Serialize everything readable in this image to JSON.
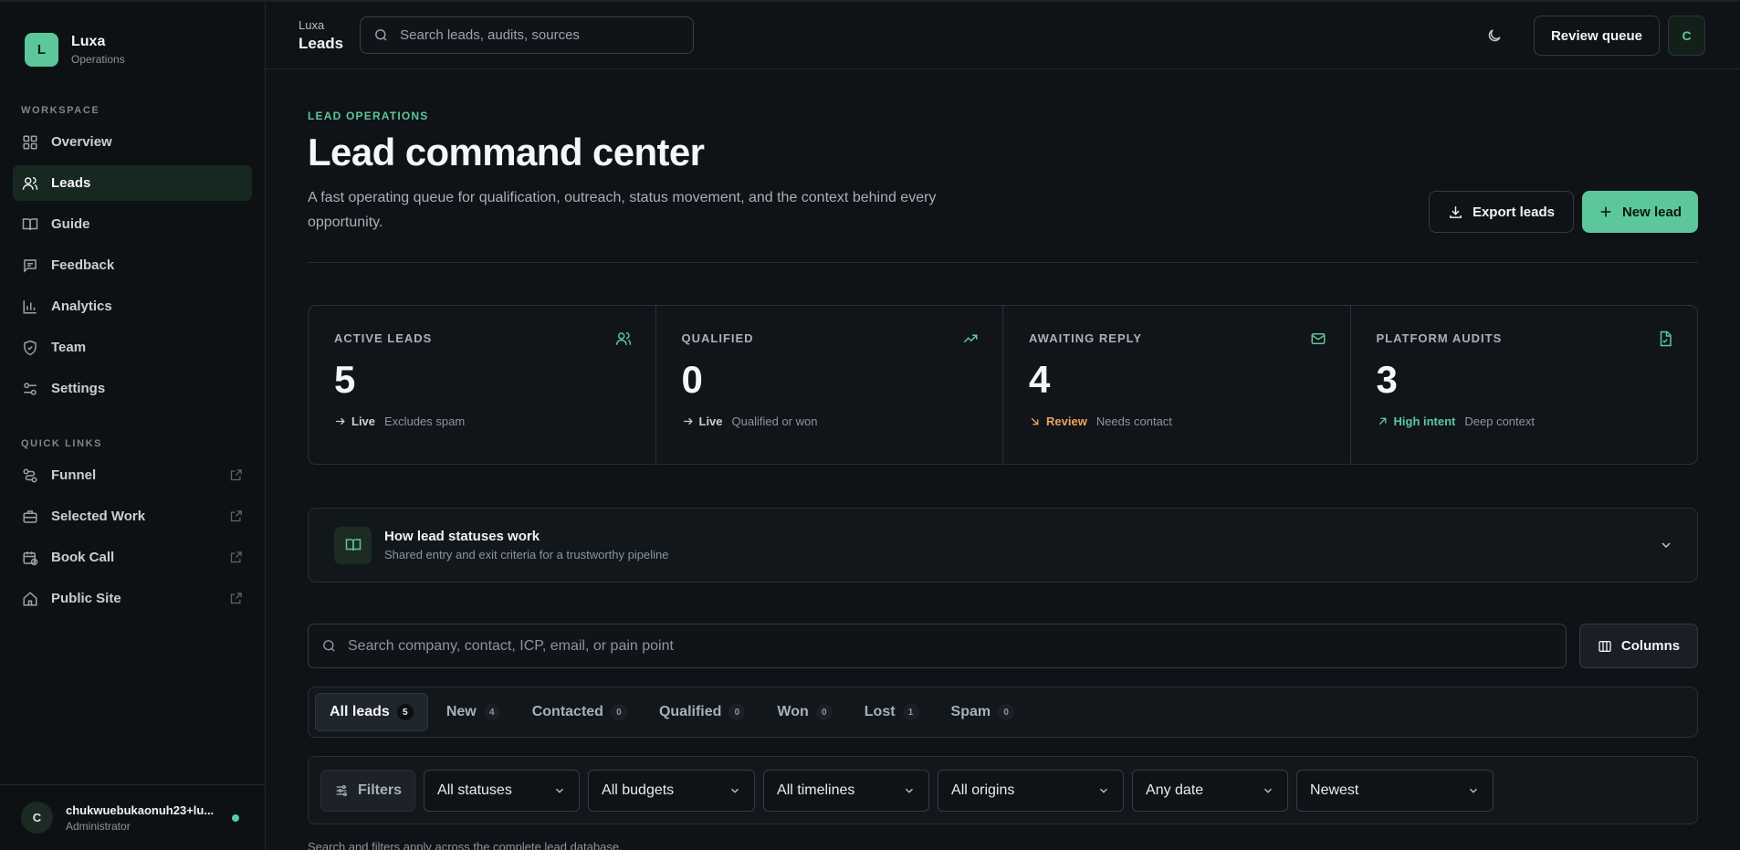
{
  "brand": {
    "logo_letter": "L",
    "name": "Luxa",
    "subtitle": "Operations"
  },
  "sidebar": {
    "workspace_label": "WORKSPACE",
    "items": [
      {
        "label": "Overview",
        "icon": "grid-icon"
      },
      {
        "label": "Leads",
        "icon": "users-icon",
        "active": true
      },
      {
        "label": "Guide",
        "icon": "book-open-icon"
      },
      {
        "label": "Feedback",
        "icon": "message-icon"
      },
      {
        "label": "Analytics",
        "icon": "bar-chart-icon"
      },
      {
        "label": "Team",
        "icon": "shield-icon"
      },
      {
        "label": "Settings",
        "icon": "sliders-icon"
      }
    ],
    "quick_links_label": "QUICK LINKS",
    "quick_links": [
      {
        "label": "Funnel",
        "icon": "route-icon"
      },
      {
        "label": "Selected Work",
        "icon": "briefcase-icon"
      },
      {
        "label": "Book Call",
        "icon": "calendar-clock-icon"
      },
      {
        "label": "Public Site",
        "icon": "home-icon"
      }
    ],
    "user": {
      "initial": "C",
      "name": "chukwuebukaonuh23+lu...",
      "role": "Administrator",
      "status_color": "#5cc7b0"
    }
  },
  "topbar": {
    "app_name": "Luxa",
    "page_name": "Leads",
    "search_placeholder": "Search leads, audits, sources",
    "review_queue_label": "Review queue",
    "avatar_initial": "C"
  },
  "header": {
    "eyebrow": "LEAD OPERATIONS",
    "title": "Lead command center",
    "description": "A fast operating queue for qualification, outreach, status movement, and the context behind every opportunity.",
    "export_label": "Export leads",
    "new_label": "New lead"
  },
  "stats": [
    {
      "label": "ACTIVE LEADS",
      "value": "5",
      "tag": "Live",
      "note": "Excludes spam",
      "icon": "users-icon",
      "tag_color": "#c9cfd4",
      "arrow": "arrow-right-icon"
    },
    {
      "label": "QUALIFIED",
      "value": "0",
      "tag": "Live",
      "note": "Qualified or won",
      "icon": "trending-up-icon",
      "tag_color": "#c9cfd4",
      "arrow": "arrow-right-icon"
    },
    {
      "label": "AWAITING REPLY",
      "value": "4",
      "tag": "Review",
      "note": "Needs contact",
      "icon": "mail-icon",
      "tag_color": "#f0a35e",
      "arrow": "arrow-down-right-icon"
    },
    {
      "label": "PLATFORM AUDITS",
      "value": "3",
      "tag": "High intent",
      "note": "Deep context",
      "icon": "file-icon",
      "tag_color": "#5cc79a",
      "arrow": "arrow-up-right-icon"
    }
  ],
  "guide": {
    "title": "How lead statuses work",
    "subtitle": "Shared entry and exit criteria for a trustworthy pipeline"
  },
  "lead_search": {
    "placeholder": "Search company, contact, ICP, email, or pain point",
    "columns_label": "Columns"
  },
  "tabs": [
    {
      "label": "All leads",
      "count": "5",
      "active": true
    },
    {
      "label": "New",
      "count": "4"
    },
    {
      "label": "Contacted",
      "count": "0"
    },
    {
      "label": "Qualified",
      "count": "0"
    },
    {
      "label": "Won",
      "count": "0"
    },
    {
      "label": "Lost",
      "count": "1"
    },
    {
      "label": "Spam",
      "count": "0"
    }
  ],
  "filters": {
    "button_label": "Filters",
    "selects": [
      "All statuses",
      "All budgets",
      "All timelines",
      "All origins",
      "Any date",
      "Newest"
    ]
  },
  "hint": "Search and filters apply across the complete lead database."
}
